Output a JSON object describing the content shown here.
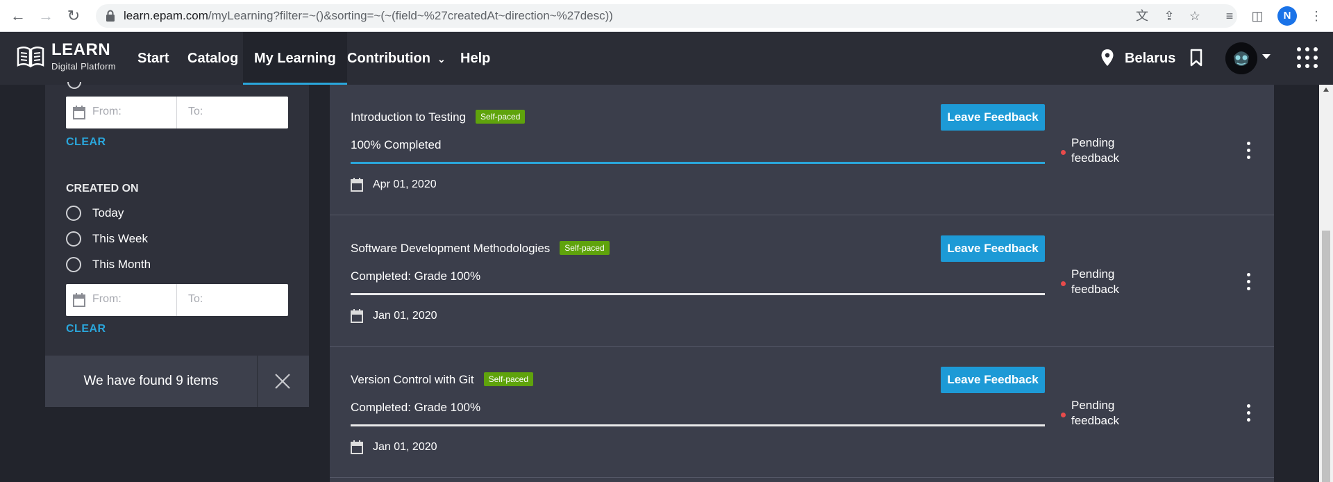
{
  "browser": {
    "url_host": "learn.epam.com",
    "url_path": "/myLearning?filter=~()&sorting=~(~(field~%27createdAt~direction~%27desc))",
    "profile_initial": "N"
  },
  "header": {
    "logo_title": "LEARN",
    "logo_subtitle": "Digital Platform",
    "nav": [
      "Start",
      "Catalog",
      "My Learning",
      "Contribution",
      "Help"
    ],
    "active_nav": "My Learning",
    "location": "Belarus"
  },
  "sidebar": {
    "date_from_placeholder": "From:",
    "date_to_placeholder": "To:",
    "clear_label": "CLEAR",
    "created_on_title": "CREATED ON",
    "created_on_options": [
      "Today",
      "This Week",
      "This Month"
    ],
    "found_text": "We have found 9 items"
  },
  "courses": [
    {
      "title": "Introduction to Testing",
      "badge": "Self-paced",
      "status": "100% Completed",
      "progress": 1.0,
      "date": "Apr 01, 2020",
      "action": "Leave Feedback",
      "feedback_status": "Pending feedback"
    },
    {
      "title": "Software Development Methodologies",
      "badge": "Self-paced",
      "status": "Completed: Grade 100%",
      "progress": 0,
      "date": "Jan 01, 2020",
      "action": "Leave Feedback",
      "feedback_status": "Pending feedback"
    },
    {
      "title": "Version Control with Git",
      "badge": "Self-paced",
      "status": "Completed: Grade 100%",
      "progress": 0,
      "date": "Jan 01, 2020",
      "action": "Leave Feedback",
      "feedback_status": "Pending feedback"
    }
  ],
  "colors": {
    "accent": "#2aa6db",
    "button": "#1d9ad6",
    "badge": "#5fa30c",
    "pending_dot": "#e84b4b",
    "header_bg": "#2b2d36",
    "list_bg": "#3b3e4b"
  }
}
